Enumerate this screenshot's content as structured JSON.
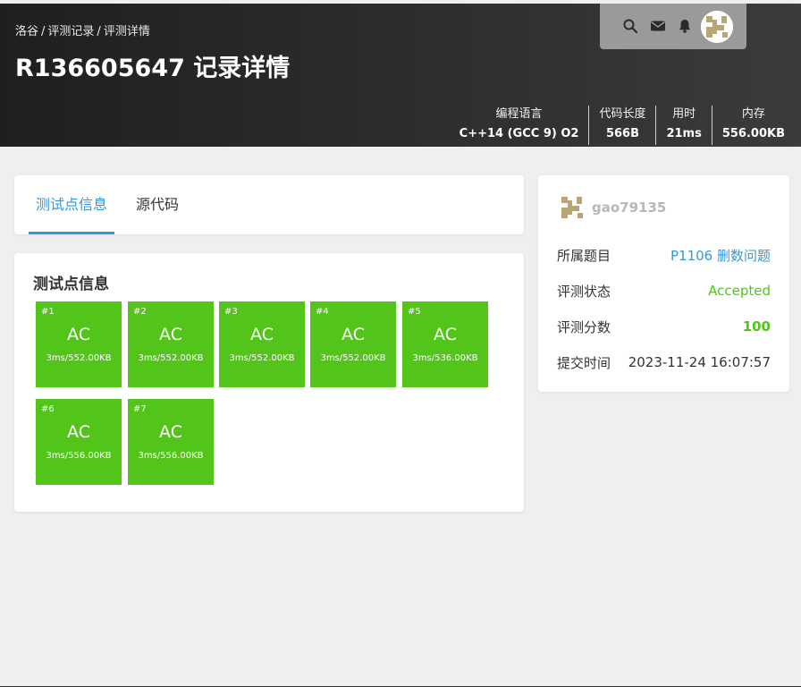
{
  "header": {
    "breadcrumb": [
      "洛谷",
      "评测记录",
      "评测详情"
    ],
    "breadcrumb_sep": "/",
    "title": "R136605647 记录详情",
    "icons": [
      "search-icon",
      "mail-icon",
      "bell-icon"
    ],
    "stats": [
      {
        "label": "编程语言",
        "value": "C++14 (GCC 9) O2"
      },
      {
        "label": "代码长度",
        "value": "566B"
      },
      {
        "label": "用时",
        "value": "21ms"
      },
      {
        "label": "内存",
        "value": "556.00KB"
      }
    ]
  },
  "tabs": [
    {
      "label": "测试点信息",
      "active": true
    },
    {
      "label": "源代码",
      "active": false
    }
  ],
  "tests": {
    "title": "测试点信息",
    "color": "#52c41a",
    "cases": [
      {
        "num": "#1",
        "status": "AC",
        "info": "3ms/552.00KB"
      },
      {
        "num": "#2",
        "status": "AC",
        "info": "3ms/552.00KB"
      },
      {
        "num": "#3",
        "status": "AC",
        "info": "3ms/552.00KB"
      },
      {
        "num": "#4",
        "status": "AC",
        "info": "3ms/552.00KB"
      },
      {
        "num": "#5",
        "status": "AC",
        "info": "3ms/536.00KB"
      },
      {
        "num": "#6",
        "status": "AC",
        "info": "3ms/556.00KB"
      },
      {
        "num": "#7",
        "status": "AC",
        "info": "3ms/556.00KB"
      }
    ]
  },
  "sidebar": {
    "username": "gao79135",
    "rows": [
      {
        "key": "所属题目",
        "value": "P1106 删数问题"
      },
      {
        "key": "评测状态",
        "value": "Accepted"
      },
      {
        "key": "评测分数",
        "value": "100"
      },
      {
        "key": "提交时间",
        "value": "2023-11-24 16:07:57"
      }
    ]
  },
  "colors": {
    "accent": "#3498db",
    "accepted": "#52c41a",
    "header_bg": "#2d2e30"
  }
}
